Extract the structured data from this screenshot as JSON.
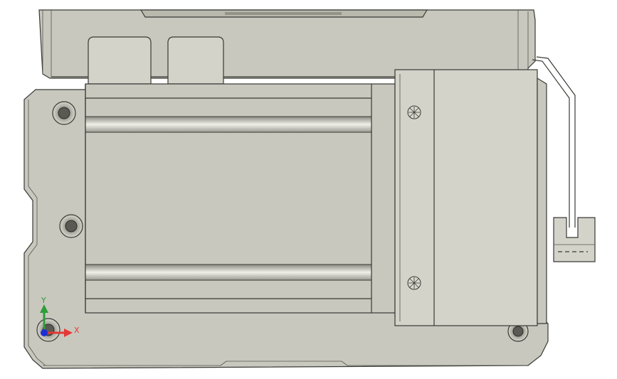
{
  "viewport": {
    "background": "#ffffff",
    "part_color": "#c8c8be",
    "edge_color": "#3a3a36"
  },
  "triad": {
    "x_label": "X",
    "y_label": "Y",
    "x_color": "#e53935",
    "y_color": "#2e9d3a",
    "z_color": "#1e2fd6"
  },
  "icons": [
    "triad-icon"
  ]
}
